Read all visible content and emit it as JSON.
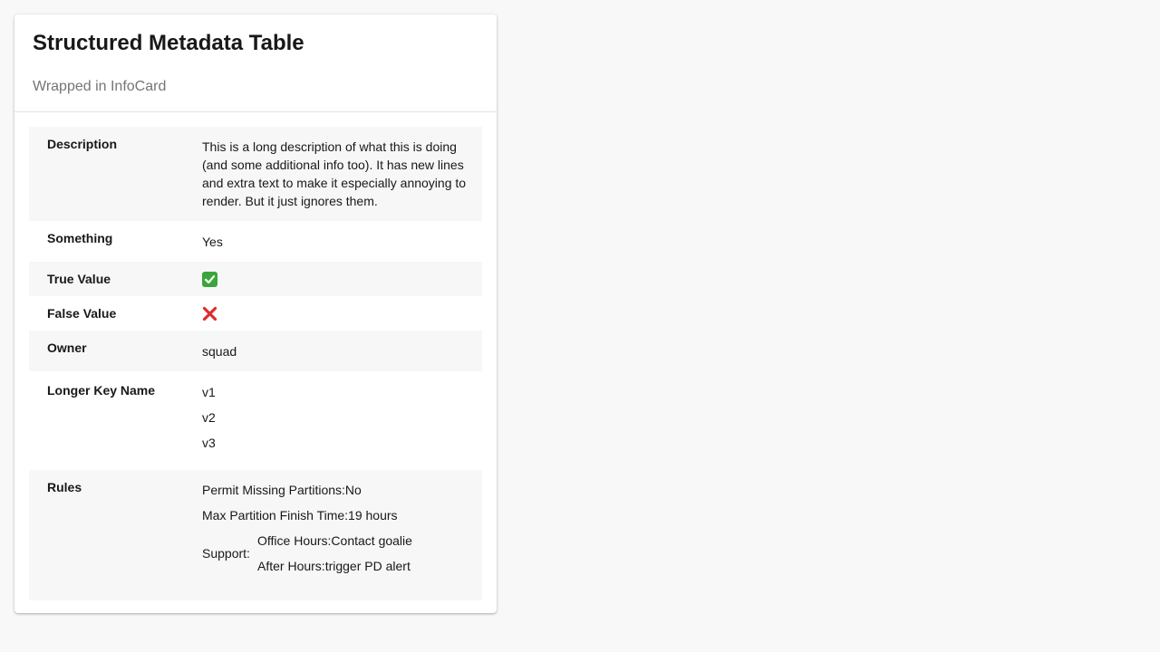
{
  "card": {
    "title": "Structured Metadata Table",
    "subtitle": "Wrapped in InfoCard"
  },
  "rows": {
    "description": {
      "key": "Description",
      "value": "This is a long description of what this is doing (and some additional info too). It has new lines and extra text to make it especially annoying to render. But it just ignores them."
    },
    "something": {
      "key": "Something",
      "value": "Yes"
    },
    "true_value": {
      "key": "True Value",
      "value": true,
      "icon": "check-mark-icon"
    },
    "false_value": {
      "key": "False Value",
      "value": false,
      "icon": "cross-mark-icon"
    },
    "owner": {
      "key": "Owner",
      "value": "squad"
    },
    "longer_key": {
      "key": "Longer Key Name",
      "values": [
        "v1",
        "v2",
        "v3"
      ]
    },
    "rules": {
      "key": "Rules",
      "permit_missing": "Permit Missing Partitions:No",
      "max_finish": "Max Partition Finish Time:19 hours",
      "support_label": "Support:",
      "office_hours": "Office Hours:Contact goalie",
      "after_hours": "After Hours:trigger PD alert"
    }
  },
  "colors": {
    "background": "#f8f8f8",
    "card": "#ffffff",
    "row_stripe": "#f7f7f7",
    "subtitle": "#757575",
    "check_green": "#3aa63a",
    "cross_red": "#dd2e2e"
  }
}
